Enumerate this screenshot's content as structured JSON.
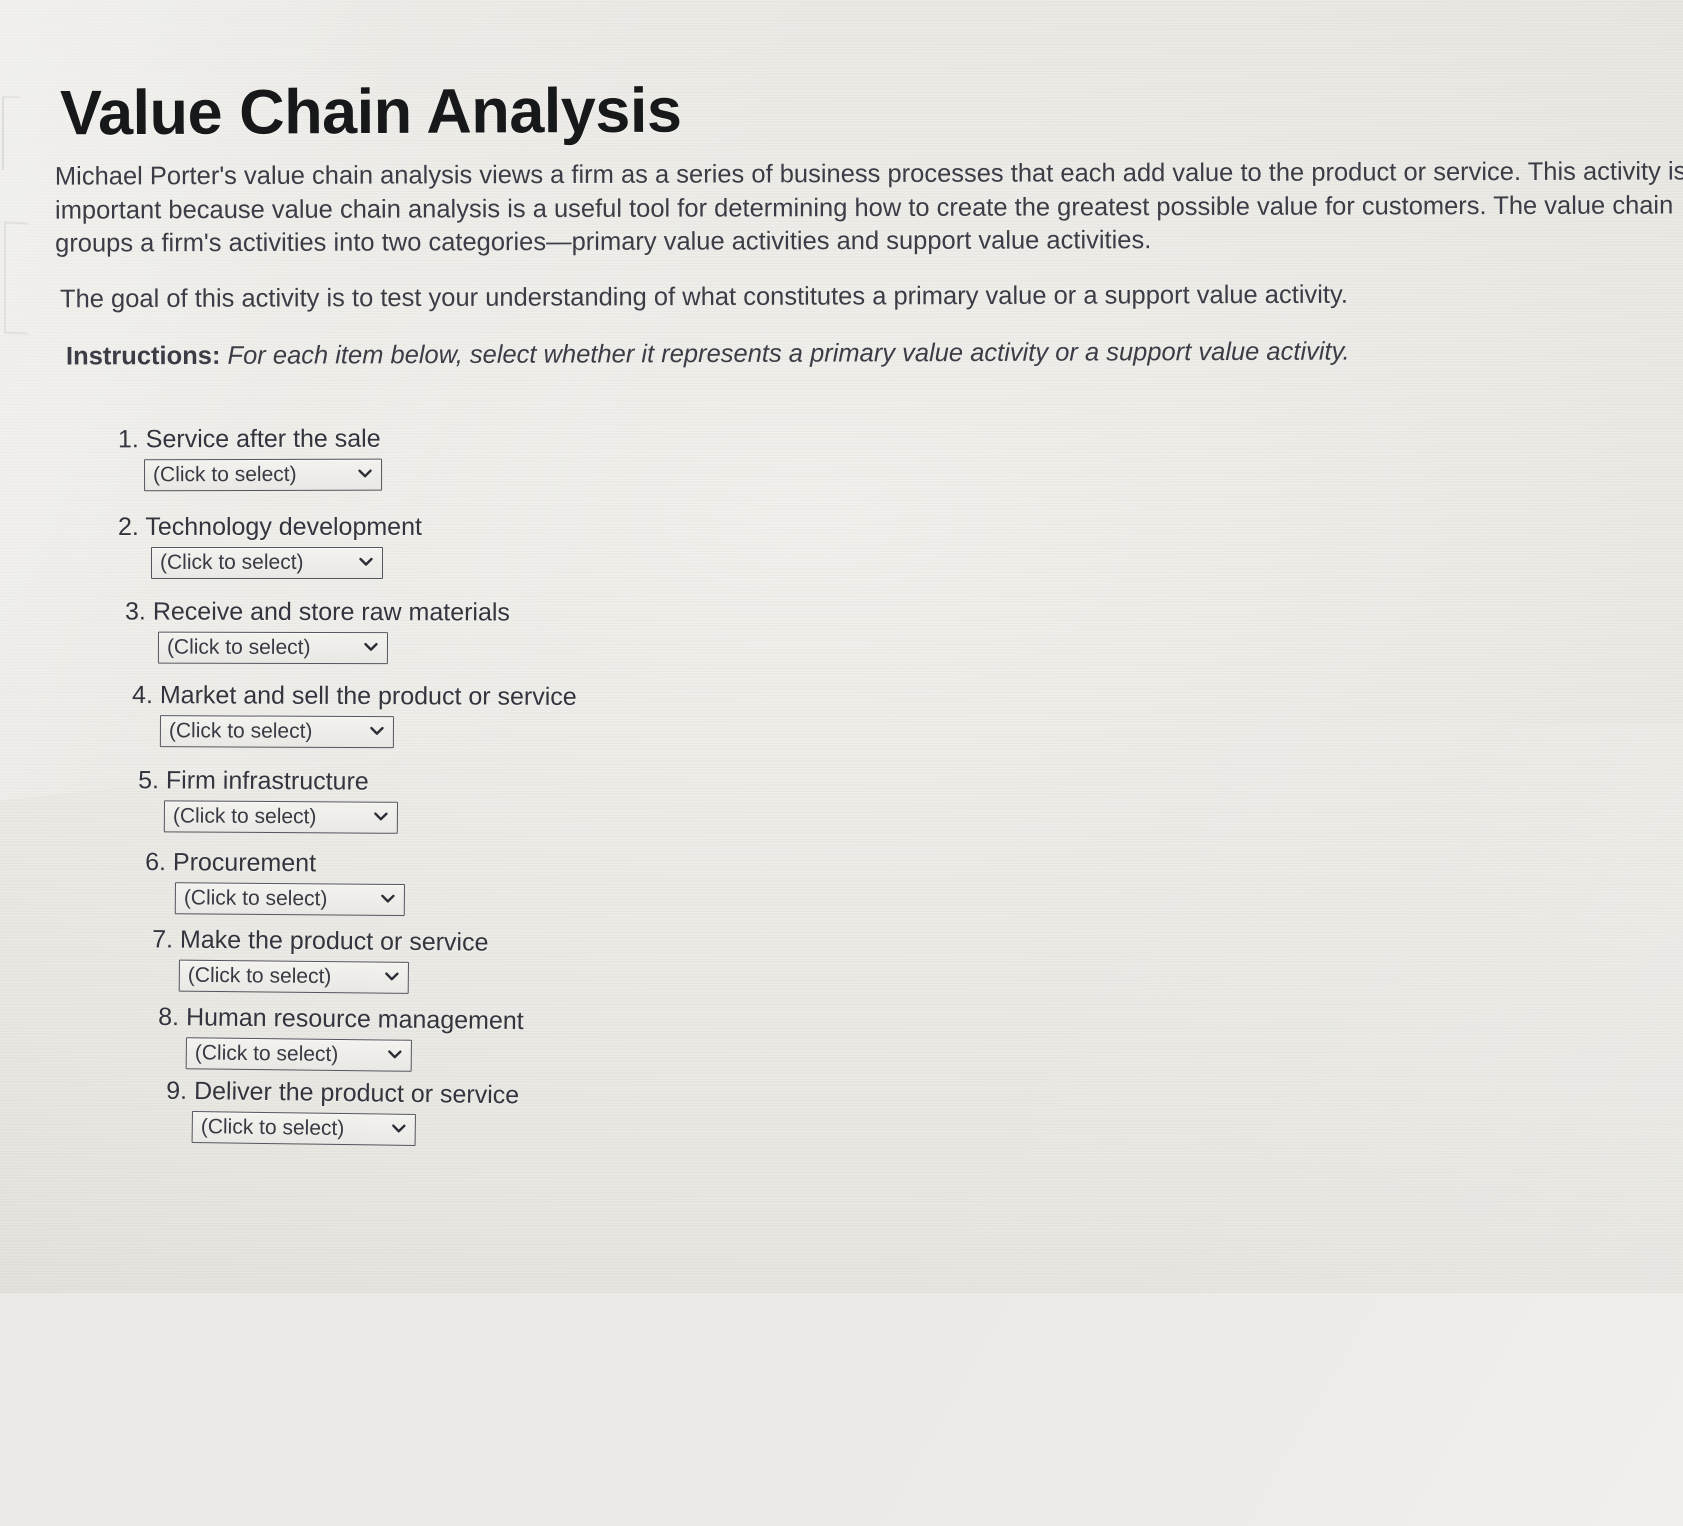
{
  "page": {
    "title": "Value Chain Analysis",
    "intro": "Michael Porter's value chain analysis views a firm as a series of business processes that each add value to the product or service. This activity is important because value chain analysis is a useful tool for determining how to create the greatest possible value for customers. The value chain groups a firm's activities into two categories—primary value activities and support value activities.",
    "goal": "The goal of this activity is to test your understanding of what constitutes a primary value or a support value activity.",
    "instructions_lead": "Instructions:",
    "instructions_body": "For each item below, select whether it represents a primary value activity or a support value activity."
  },
  "select_placeholder": "(Click to select)",
  "dropdown_icon": "chevron-down-icon",
  "questions": [
    {
      "number": "1.",
      "text": "Service after the sale",
      "value": "(Click to select)"
    },
    {
      "number": "2.",
      "text": "Technology development",
      "value": "(Click to select)"
    },
    {
      "number": "3.",
      "text": "Receive and store raw materials",
      "value": "(Click to select)"
    },
    {
      "number": "4.",
      "text": "Market and sell the product or service",
      "value": "(Click to select)"
    },
    {
      "number": "5.",
      "text": "Firm infrastructure",
      "value": "(Click to select)"
    },
    {
      "number": "6.",
      "text": "Procurement",
      "value": "(Click to select)"
    },
    {
      "number": "7.",
      "text": "Make the product or service",
      "value": "(Click to select)"
    },
    {
      "number": "8.",
      "text": "Human resource management",
      "value": "(Click to select)"
    },
    {
      "number": "9.",
      "text": "Deliver the product or service",
      "value": "(Click to select)"
    }
  ],
  "colors": {
    "background": "#eceae6",
    "title_text": "#17181a",
    "body_text": "#3c3c46",
    "select_border": "#55555f"
  }
}
